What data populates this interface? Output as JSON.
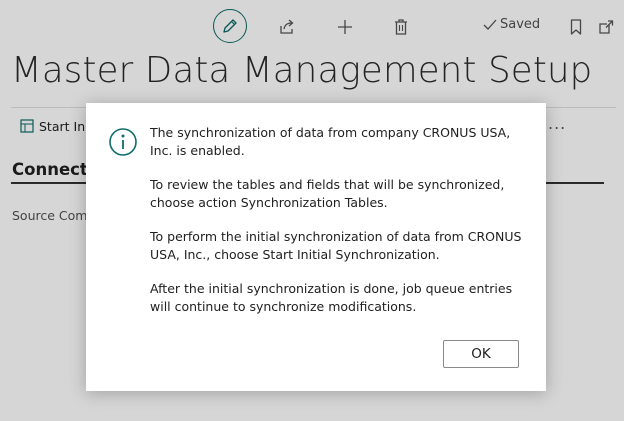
{
  "header": {
    "saved_label": "Saved",
    "icons": [
      "edit-icon",
      "share-icon",
      "plus-icon",
      "trash-icon",
      "checkmark-icon",
      "bookmark-icon",
      "popout-icon"
    ]
  },
  "page": {
    "title": "Master Data Management Setup",
    "action_start_initial": "Start Init",
    "more_actions": "...",
    "section_title": "Connectio",
    "field_source_company": "Source Comp"
  },
  "dialog": {
    "messages": [
      "The synchronization of data from company CRONUS USA, Inc. is enabled.",
      "To review the tables and fields that will be synchronized, choose action Synchronization Tables.",
      "To perform the initial synchronization of data from CRONUS USA, Inc., choose Start Initial Synchronization.",
      "After the initial synchronization is done, job queue entries will continue to synchronize modifications."
    ],
    "ok_label": "OK",
    "icon": "info-icon"
  },
  "colors": {
    "accent": "#0f6d6a",
    "overlay": "#000000",
    "text": "#212121"
  }
}
